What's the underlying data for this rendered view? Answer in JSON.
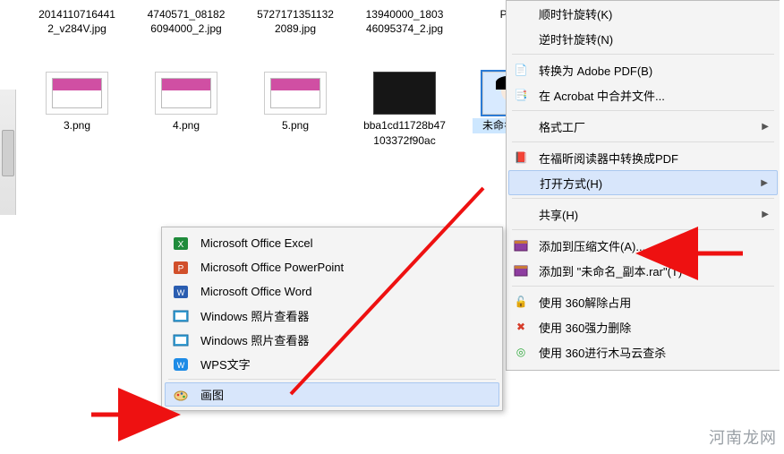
{
  "files_row1": [
    {
      "name": "20141107164412_v284V.jpg"
    },
    {
      "name": "4740571_081826094000_2.jpg"
    },
    {
      "name": "57271713511322089.jpg"
    },
    {
      "name": "13940000_180346095374_2.jpg"
    },
    {
      "name": "Pytho"
    }
  ],
  "files_row2": [
    {
      "name": "3.png",
      "type": "doc"
    },
    {
      "name": "4.png",
      "type": "doc"
    },
    {
      "name": "5.png",
      "type": "doc"
    },
    {
      "name": "bba1cd11728b47103372f90ac",
      "type": "dark"
    },
    {
      "name": "未命名_副本.",
      "type": "face",
      "selected": true
    }
  ],
  "context_menu": {
    "rotate_cw": "顺时针旋转(K)",
    "rotate_ccw": "逆时针旋转(N)",
    "to_pdf": "转换为 Adobe PDF(B)",
    "acrobat_merge": "在 Acrobat 中合并文件...",
    "format_factory": "格式工厂",
    "foxit_pdf": "在福昕阅读器中转换成PDF",
    "open_with": "打开方式(H)",
    "share": "共享(H)",
    "add_archive": "添加到压缩文件(A)...",
    "add_named_rar": "添加到 \"未命名_副本.rar\"(T)",
    "use360_unlock": "使用 360解除占用",
    "use360_force": "使用 360强力删除",
    "use360_scan": "使用 360进行木马云查杀"
  },
  "open_with_menu": {
    "excel": "Microsoft Office Excel",
    "ppt": "Microsoft Office PowerPoint",
    "word": "Microsoft Office Word",
    "photo_viewer1": "Windows 照片查看器",
    "photo_viewer2": "Windows 照片查看器",
    "wps": "WPS文字",
    "paint": "画图"
  },
  "watermark": "河南龙网"
}
